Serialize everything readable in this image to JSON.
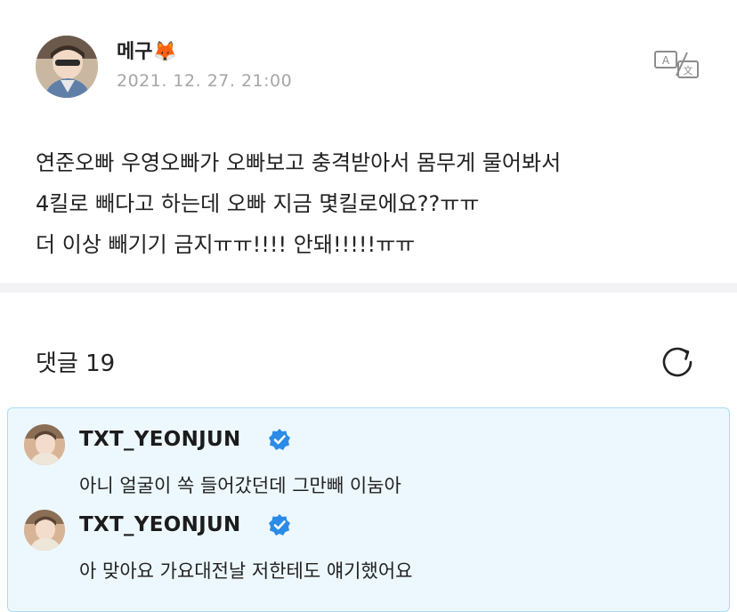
{
  "post": {
    "author": "메구🦊",
    "date": "2021. 12. 27. 21:00",
    "body_lines": [
      "연준오빠 우영오빠가 오빠보고 충격받아서 몸무게 물어봐서",
      "4킬로 빼다고 하는데 오빠 지금 몇킬로에요??ㅠㅠ",
      "더 이상 빼기기 금지ㅠㅠ!!!! 안돼!!!!!ㅠㅠ"
    ],
    "translate_icon": "translate-icon"
  },
  "comments": {
    "title": "댓글 19",
    "refresh_icon": "refresh-icon",
    "items": [
      {
        "name": "TXT_YEONJUN",
        "text": "아니 얼굴이 쏙 들어갔던데 그만빼 이눔아"
      },
      {
        "name": "TXT_YEONJUN",
        "text": "아 맞아요 가요대전날 저한테도 얘기했어요"
      }
    ]
  },
  "colors": {
    "verified_badge": "#2b8be6",
    "artist_box_bg": "#edf8fe",
    "artist_box_border": "#a7ddf3",
    "date_gray": "#a6a6a6"
  }
}
